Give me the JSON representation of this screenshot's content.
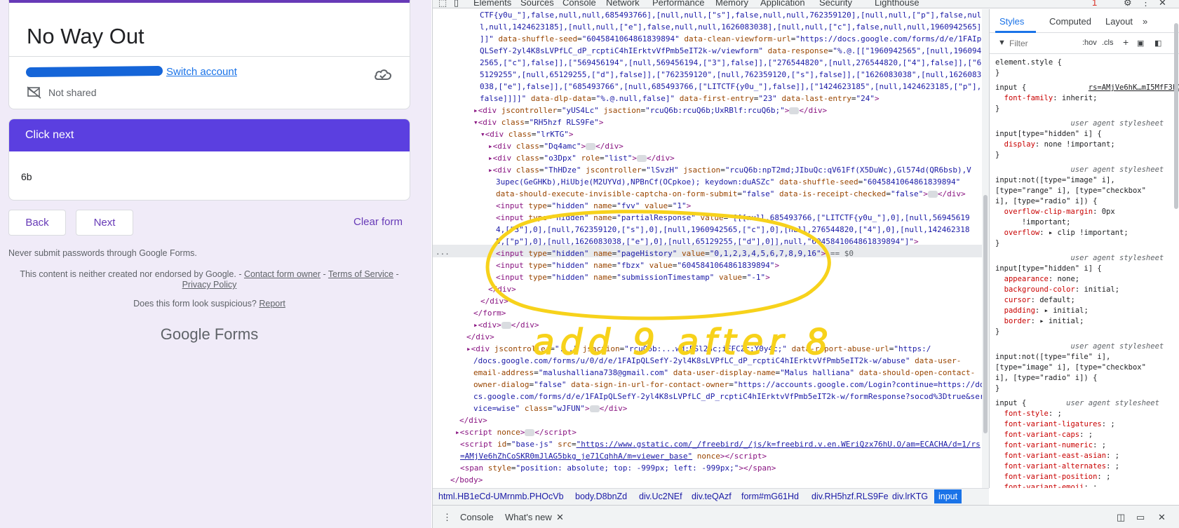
{
  "form": {
    "title": "No Way Out",
    "switch_account": "Switch account",
    "not_shared": "Not shared",
    "question_header": "Click next",
    "question_text": "6b",
    "back": "Back",
    "next": "Next",
    "clear": "Clear form",
    "never_submit": "Never submit passwords through Google Forms.",
    "disclaimer_prefix": "This content is neither created nor endorsed by Google. - ",
    "contact_owner": "Contact form owner",
    "sep": " - ",
    "terms": "Terms of Service",
    "sep2": " -",
    "privacy": "Privacy Policy",
    "suspicious_prefix": "Does this form look suspicious? ",
    "report": "Report",
    "logo_google": "Google",
    "logo_forms": " Forms"
  },
  "devtools": {
    "tabs": [
      "Elements",
      "Sources",
      "Console",
      "Network",
      "Performance",
      "Memory",
      "Application",
      "Security",
      "Lighthouse"
    ],
    "error_count": "1",
    "styles_tabs": [
      "Styles",
      "Computed",
      "Layout"
    ],
    "filter_placeholder": "Filter",
    "hov": ":hov",
    "cls": ".cls",
    "breadcrumbs": [
      "html.HB1eCd-UMrnmb.PHOcVb",
      "body.D8bnZd",
      "div.Uc2NEf",
      "div.teQAzf",
      "form#mG61Hd",
      "div.RH5hzf.RLS9Fe",
      "div.lrKTG",
      "input"
    ],
    "drawer_tabs": [
      "Console",
      "What's new"
    ]
  },
  "annotation": {
    "handwritten": "add 9 after 8"
  }
}
